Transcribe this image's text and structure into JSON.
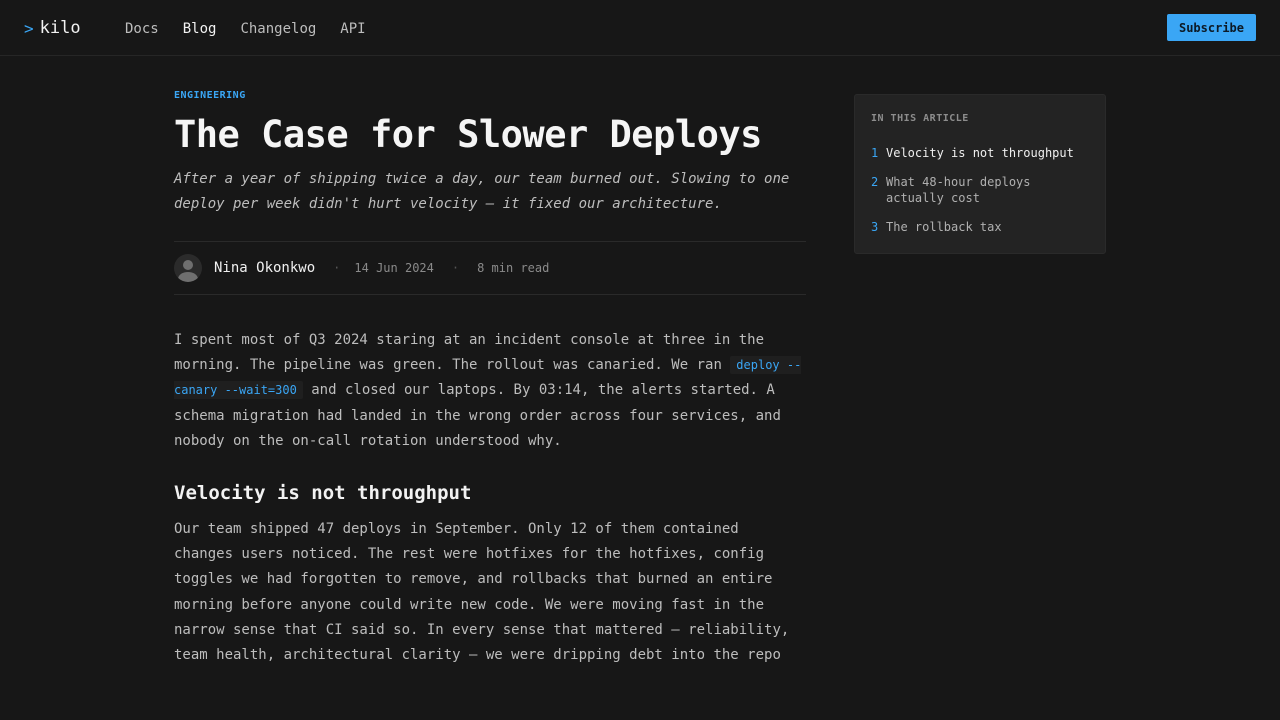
{
  "brand": {
    "prompt": ">",
    "name": "kilo"
  },
  "nav": {
    "items": [
      {
        "label": "Docs"
      },
      {
        "label": "Blog"
      },
      {
        "label": "Changelog"
      },
      {
        "label": "API"
      }
    ],
    "active": "Blog"
  },
  "header": {
    "subscribe_label": "Subscribe"
  },
  "article": {
    "category": "ENGINEERING",
    "title": "The Case for Slower Deploys",
    "subtitle": "After a year of shipping twice a day, our team burned out. Slowing to one deploy per week didn't hurt velocity — it fixed our architecture.",
    "author": "Nina Okonkwo",
    "date": "14 Jun 2024",
    "read_time": "8 min read",
    "separator": "·",
    "intro_before_code": "I spent most of Q3 2024 staring at an incident console at three in the morning. The pipeline was green. The rollout was canaried. We ran ",
    "intro_code": "deploy --canary --wait=300",
    "intro_after_code": " and closed our laptops. By 03:14, the alerts started. A schema migration had landed in the wrong order across four services, and nobody on the on-call rotation understood why.",
    "section1_heading": "Velocity is not throughput",
    "section1_body": "Our team shipped 47 deploys in September. Only 12 of them contained changes users noticed. The rest were hotfixes for the hotfixes, config toggles we had forgotten to remove, and rollbacks that burned an entire morning before anyone could write new code. We were moving fast in the narrow sense that CI said so. In every sense that mattered — reliability, team health, architectural clarity — we were dripping debt into the repo"
  },
  "toc": {
    "heading": "IN THIS ARTICLE",
    "items": [
      {
        "num": "1",
        "label": "Velocity is not throughput"
      },
      {
        "num": "2",
        "label": "What 48-hour deploys actually cost"
      },
      {
        "num": "3",
        "label": "The rollback tax"
      }
    ]
  },
  "colors": {
    "accent": "#3aa6f5",
    "background": "#171717",
    "panel": "#232323"
  }
}
